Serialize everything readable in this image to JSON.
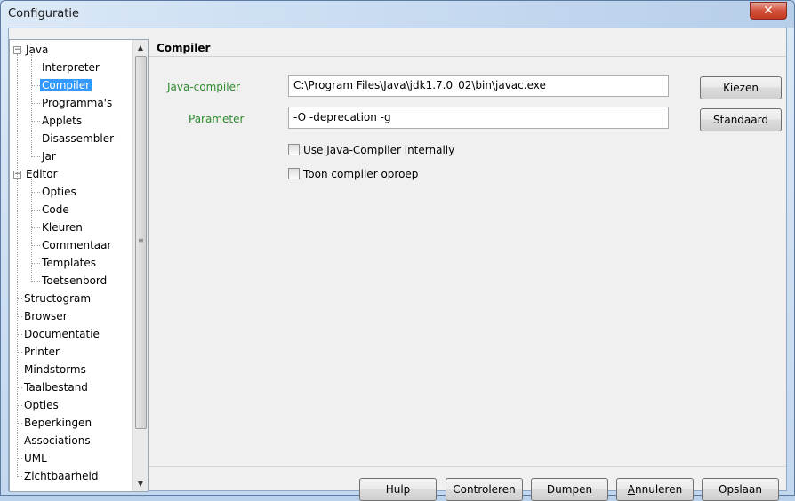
{
  "window": {
    "title": "Configuratie",
    "close_glyph": "✕"
  },
  "tree": {
    "nodes": [
      {
        "label": "Java",
        "level": 0,
        "expander": "−",
        "selected": false
      },
      {
        "label": "Interpreter",
        "level": 1
      },
      {
        "label": "Compiler",
        "level": 1,
        "selected": true
      },
      {
        "label": "Programma's",
        "level": 1
      },
      {
        "label": "Applets",
        "level": 1
      },
      {
        "label": "Disassembler",
        "level": 1
      },
      {
        "label": "Jar",
        "level": 1
      },
      {
        "label": "Editor",
        "level": 0,
        "expander": "−"
      },
      {
        "label": "Opties",
        "level": 1
      },
      {
        "label": "Code",
        "level": 1
      },
      {
        "label": "Kleuren",
        "level": 1
      },
      {
        "label": "Commentaar",
        "level": 1
      },
      {
        "label": "Templates",
        "level": 1
      },
      {
        "label": "Toetsenbord",
        "level": 1
      },
      {
        "label": "Structogram",
        "level": 0
      },
      {
        "label": "Browser",
        "level": 0
      },
      {
        "label": "Documentatie",
        "level": 0
      },
      {
        "label": "Printer",
        "level": 0
      },
      {
        "label": "Mindstorms",
        "level": 0
      },
      {
        "label": "Taalbestand",
        "level": 0
      },
      {
        "label": "Opties",
        "level": 0
      },
      {
        "label": "Beperkingen",
        "level": 0
      },
      {
        "label": "Associations",
        "level": 0
      },
      {
        "label": "UML",
        "level": 0
      },
      {
        "label": "Zichtbaarheid",
        "level": 0
      }
    ],
    "scroll": {
      "up": "▲",
      "down": "▼",
      "grip": "≡"
    }
  },
  "content": {
    "heading": "Compiler",
    "compiler_label": "Java-compiler",
    "compiler_value": "C:\\Program Files\\Java\\jdk1.7.0_02\\bin\\javac.exe",
    "choose_button": "Kiezen",
    "parameter_label": "Parameter",
    "parameter_value": "-O -deprecation -g",
    "standard_button": "Standaard",
    "checkbox_internal": "Use Java-Compiler internally",
    "checkbox_show_call": "Toon compiler oproep"
  },
  "footer": {
    "help": "Hulp",
    "check": "Controleren",
    "dump": "Dumpen",
    "cancel": "Annuleren",
    "save": "Opslaan"
  }
}
